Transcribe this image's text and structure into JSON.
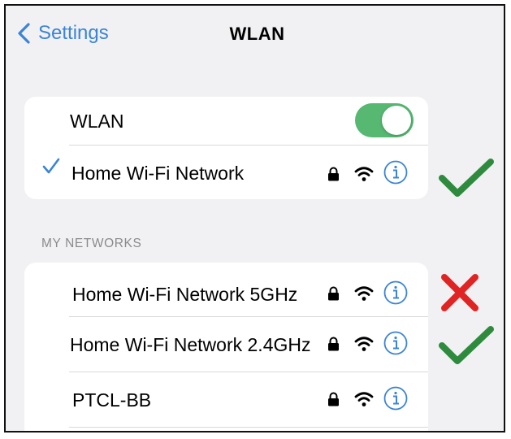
{
  "nav": {
    "back_label": "Settings",
    "title": "WLAN",
    "back_icon": "chevron-left-icon"
  },
  "wlan_card": {
    "toggle_label": "WLAN",
    "toggle_on": true,
    "connected_network": "Home Wi-Fi Network"
  },
  "section_header": "MY NETWORKS",
  "networks": [
    {
      "name": "Home Wi-Fi Network 5GHz",
      "secured": true,
      "marker": "red-cross"
    },
    {
      "name": "Home Wi-Fi Network 2.4GHz",
      "secured": true,
      "marker": "green-check"
    },
    {
      "name": "PTCL-BB",
      "secured": true,
      "marker": "none"
    }
  ],
  "colors": {
    "accent": "#3b84d6",
    "toggle_on": "#56b871",
    "green_check": "#2e8b3e",
    "red_cross": "#e02424",
    "background": "#f1f1f3"
  }
}
